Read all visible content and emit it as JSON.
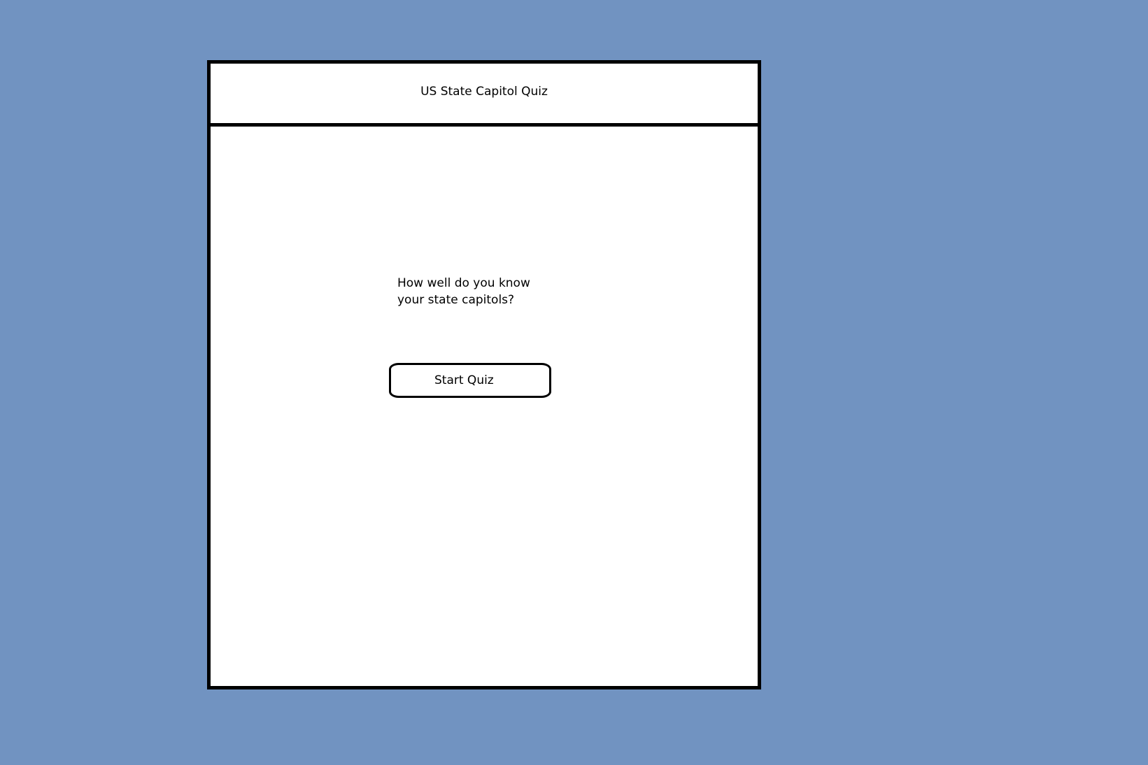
{
  "app": {
    "title": "US State Capitol Quiz"
  },
  "intro": {
    "line1": "How well do you know",
    "line2": "your state capitols?"
  },
  "actions": {
    "start_label": "Start Quiz"
  },
  "colors": {
    "background": "#7193c1",
    "panel": "#ffffff",
    "border": "#000000"
  }
}
